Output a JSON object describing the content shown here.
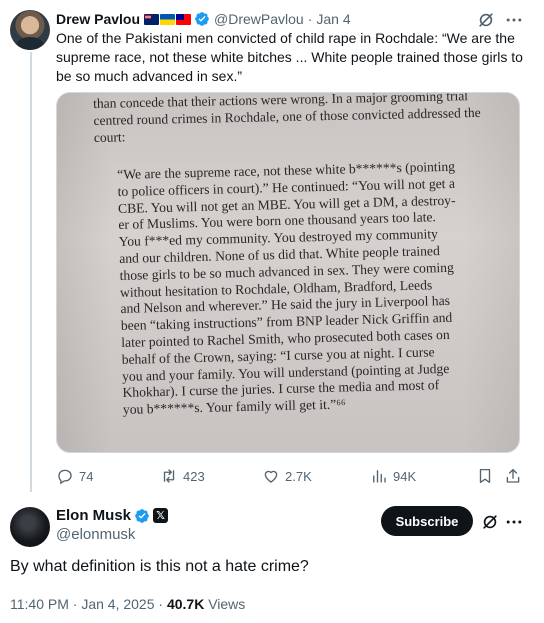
{
  "parent_tweet": {
    "name": "Drew Pavlou",
    "handle": "@DrewPavlou",
    "date": "Jan 4",
    "text": "One of the Pakistani men convicted of child rape in Rochdale: “We are the supreme race, not these white bitches ... White people trained those girls to be so much advanced in sex.”",
    "image_text": {
      "top_lines": [
        "than concede that their actions were wrong. In a major grooming trial",
        "centred round crimes in Rochdale, one of those convicted addressed the",
        "court:"
      ],
      "quote_lines": [
        "“We are the supreme race, not these white b******s (pointing",
        "to police officers in court).” He continued: “You will not get a",
        "CBE. You will not get an MBE. You will get a DM, a destroy-",
        "er of Muslims. You were born one thousand years too late.",
        "You f***ed my community. You destroyed my community",
        "and our children. None of us did that. White people trained",
        "those girls to be so much advanced in sex. They were coming",
        "without hesitation to Rochdale, Oldham, Bradford, Leeds",
        "and Nelson and wherever.” He said the jury in Liverpool has",
        "been “taking instructions” from BNP leader Nick Griffin and",
        "later pointed to Rachel Smith, who prosecuted both cases on",
        "behalf of the Crown, saying: “I curse you at night. I curse",
        "you and your family. You will understand (pointing at Judge",
        "Khokhar). I curse the juries. I curse the media and most of",
        "you b******s. Your family will get it.”⁶⁶"
      ]
    },
    "stats": {
      "replies": "74",
      "reposts": "423",
      "likes": "2.7K",
      "views": "94K"
    }
  },
  "main_tweet": {
    "name": "Elon Musk",
    "handle": "@elonmusk",
    "subscribe_label": "Subscribe",
    "text": "By what definition is this not a hate crime?",
    "timestamp": "11:40 PM · Jan 4, 2025 · ",
    "views_count": "40.7K",
    "views_label": " Views"
  },
  "colors": {
    "text_primary": "#0f1419",
    "text_secondary": "#536471",
    "verified_blue": "#1d9bf0",
    "subscribe_bg": "#0f1419"
  },
  "icons": [
    "reply-icon",
    "retweet-icon",
    "like-icon",
    "views-icon",
    "bookmark-icon",
    "share-icon",
    "grok-icon",
    "more-icon",
    "verified-badge-icon",
    "x-affiliate-badge-icon"
  ]
}
